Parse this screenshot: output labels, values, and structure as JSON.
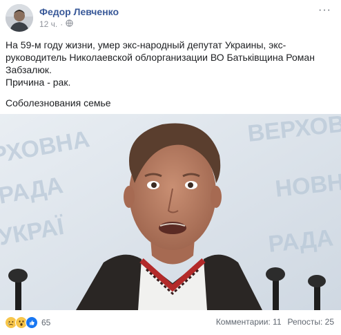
{
  "post": {
    "author": "Федор Левченко",
    "time": "12 ч.",
    "dot": "·",
    "menu_glyph": "···",
    "text_line1": "На 59-м году жизни, умер экс-народный депутат Украины, экс-руководитель Николаевской облорганизации ВО Батьківщина Роман Забзалюк.",
    "text_line2": "Причина - рак.",
    "text_line3": "Соболезнования семье",
    "image_semantic": "portrait-photo",
    "reactions": {
      "icons": [
        "sad-reaction-icon",
        "wow-reaction-icon",
        "like-reaction-icon"
      ],
      "count": "65"
    },
    "comments_label": "Комментарии: 11",
    "shares_label": "Репосты: 25",
    "accent_color": "#385898",
    "like_color": "#1877f2",
    "reaction_yellow": "#f7c64b"
  }
}
